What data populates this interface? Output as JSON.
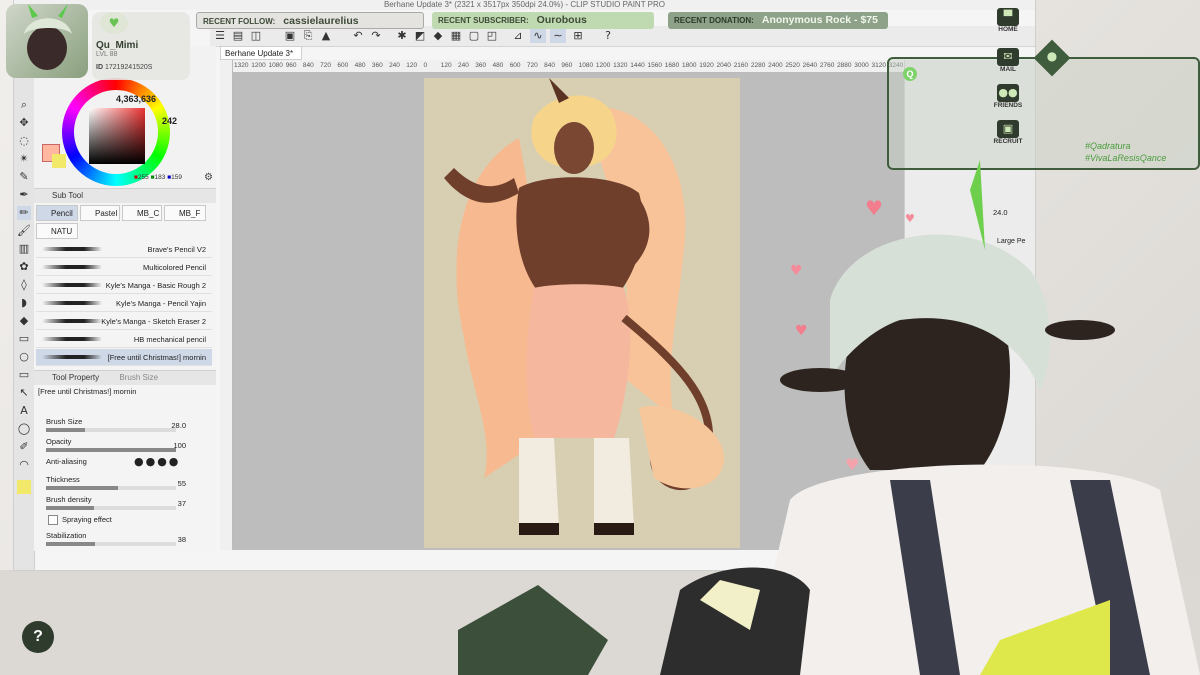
{
  "window": {
    "title": "Berhane Update 3* (2321 x 3517px 350dpi 24.0%) - CLIP STUDIO PAINT PRO"
  },
  "profile": {
    "name": "Qu_Mimi",
    "level": "LVL 88",
    "id_label": "ID",
    "id_value": "17219241520S"
  },
  "alerts": {
    "recent_follow_label": "RECENT FOLLOW:",
    "recent_follow_value": "cassielaurelius",
    "recent_subscriber_label": "RECENT SUBSCRIBER:",
    "recent_subscriber_value": "Ourobous",
    "recent_donation_label": "RECENT DONATION:",
    "recent_donation_value": "Anonymous Rock - $75"
  },
  "nav": {
    "items": [
      {
        "label": "HOME",
        "icon": "hat-icon"
      },
      {
        "label": "MAIL",
        "icon": "envelope-icon"
      },
      {
        "label": "FRIENDS",
        "icon": "friends-icon"
      },
      {
        "label": "RECRUIT",
        "icon": "recruit-icon"
      }
    ]
  },
  "social": {
    "hashtags": [
      "#Qadratura",
      "#VivaLaResisQance"
    ]
  },
  "color_panel": {
    "hex_readout": "4,363,636",
    "value_readout": "242",
    "rgb": [
      "255",
      "183",
      "159"
    ],
    "accent": "#ffb79f"
  },
  "doc_tab": {
    "label": "Berhane Update 3*"
  },
  "ruler": {
    "ticks": [
      "1320",
      "1200",
      "1080",
      "960",
      "840",
      "720",
      "600",
      "480",
      "360",
      "240",
      "120",
      "0",
      "120",
      "240",
      "360",
      "480",
      "600",
      "720",
      "840",
      "960",
      "1080",
      "1200",
      "1320",
      "1440",
      "1560",
      "1680",
      "1800",
      "1920",
      "2040",
      "2160",
      "2280",
      "2400",
      "2520",
      "2640",
      "2760",
      "2880",
      "3000",
      "3120",
      "3240"
    ]
  },
  "sub_tool": {
    "header": "Sub Tool",
    "tabs": [
      "Pencil",
      "Pastel",
      "MB_C",
      "MB_F",
      "NATU"
    ],
    "brushes": [
      "Brave's Pencil V2",
      "Multicolored Pencil",
      "Kyle's Manga - Basic Rough 2",
      "Kyle's Manga - Pencil Yajin",
      "Kyle's Manga - Sketch Eraser 2",
      "HB mechanical pencil",
      "[Free until Christmas!] mornin"
    ]
  },
  "tool_property": {
    "header": "Tool Property",
    "header2": "Brush Size",
    "brush_name": "[Free until Christmas!] mornin",
    "props": [
      {
        "label": "Brush Size",
        "value": "28.0",
        "fill": 0.3
      },
      {
        "label": "Opacity",
        "value": "100",
        "fill": 1.0
      },
      {
        "label": "Anti-aliasing",
        "value": "",
        "fill": 0
      },
      {
        "label": "Thickness",
        "value": "55",
        "fill": 0.55
      },
      {
        "label": "Brush density",
        "value": "37",
        "fill": 0.37
      },
      {
        "label": "Spraying effect",
        "value": "",
        "fill": 0
      },
      {
        "label": "Stabilization",
        "value": "38",
        "fill": 0.38
      }
    ]
  },
  "right_panel": {
    "value": "24.0",
    "layer_label": "Large Pe"
  },
  "help": {
    "label": "?"
  }
}
